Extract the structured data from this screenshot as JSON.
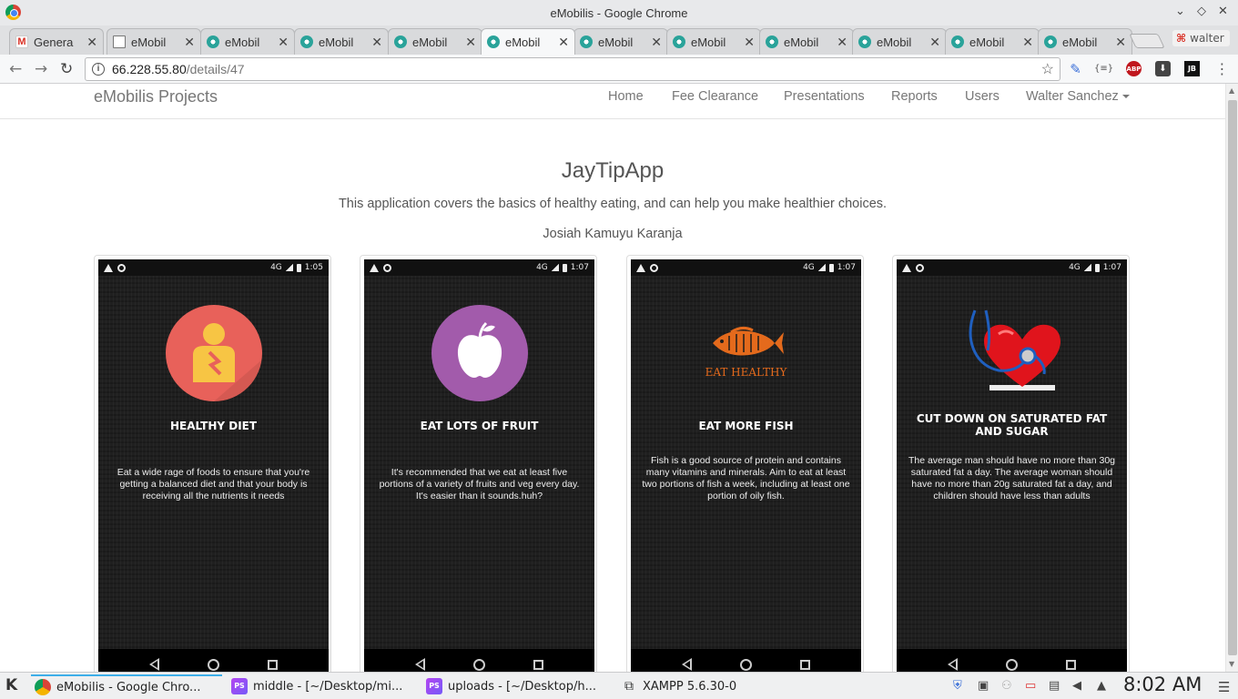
{
  "window": {
    "title": "eMobilis - Google Chrome"
  },
  "tabs": [
    {
      "label": "Genera",
      "icon": "gmail-icon",
      "active": false
    },
    {
      "label": "eMobil",
      "icon": "document-icon",
      "active": false
    },
    {
      "label": "eMobil",
      "icon": "emobilis-favicon",
      "active": false
    },
    {
      "label": "eMobil",
      "icon": "emobilis-favicon",
      "active": false
    },
    {
      "label": "eMobil",
      "icon": "emobilis-favicon",
      "active": false
    },
    {
      "label": "eMobil",
      "icon": "emobilis-favicon",
      "active": true
    },
    {
      "label": "eMobil",
      "icon": "emobilis-favicon",
      "active": false
    },
    {
      "label": "eMobil",
      "icon": "emobilis-favicon",
      "active": false
    },
    {
      "label": "eMobil",
      "icon": "emobilis-favicon",
      "active": false
    },
    {
      "label": "eMobil",
      "icon": "emobilis-favicon",
      "active": false
    },
    {
      "label": "eMobil",
      "icon": "emobilis-favicon",
      "active": false
    },
    {
      "label": "eMobil",
      "icon": "emobilis-favicon",
      "active": false
    }
  ],
  "profile": {
    "name": "walter"
  },
  "address": {
    "host": "66.228.55.80",
    "path": "/details/47"
  },
  "extensions": {
    "abp": "ABP",
    "jb": "JB",
    "bracket": "{≡}"
  },
  "site": {
    "brand": "eMobilis Projects",
    "nav": [
      "Home",
      "Fee Clearance",
      "Presentations",
      "Reports",
      "Users"
    ],
    "user_menu": "Walter Sanchez"
  },
  "project": {
    "title": "JayTipApp",
    "description": "This application covers the basics of healthy eating, and can help you make healthier choices.",
    "author": "Josiah Kamuyu Karanja"
  },
  "screens": [
    {
      "time": "1:05",
      "network": "4G",
      "heading": "HEALTHY DIET",
      "body": "Eat a wide rage of foods to ensure that you're getting a balanced diet and that your body is receiving all the nutrients it needs",
      "icon": "person-icon",
      "accent": "#e8615a"
    },
    {
      "time": "1:07",
      "network": "4G",
      "heading": "EAT LOTS OF FRUIT",
      "body": "It's recommended that we eat at least five portions of a variety of fruits and veg every day. It's easier than it sounds.huh?",
      "icon": "apple-icon",
      "accent": "#a25bab"
    },
    {
      "time": "1:07",
      "network": "4G",
      "heading": "EAT MORE FISH",
      "body": "Fish is a good source of protein and contains many vitamins and minerals. Aim to eat at least two portions of fish a week, including at least one portion of oily fish.",
      "icon": "fish-icon",
      "accent": "#e46a1c",
      "logo_text": "EAT HEALTHY"
    },
    {
      "time": "1:07",
      "network": "4G",
      "heading": "CUT DOWN ON SATURATED FAT AND SUGAR",
      "body": "The average man should have no more than 30g saturated fat a day. The average woman should have no more than 20g saturated fat a day, and children should have less than adults",
      "icon": "heart-stethoscope-icon",
      "accent": "#e0141c"
    }
  ],
  "taskbar": {
    "tasks": [
      "eMobilis - Google Chro...",
      "middle - [~/Desktop/mi...",
      "uploads - [~/Desktop/h...",
      "XAMPP 5.6.30-0"
    ],
    "clock": "8:02 AM"
  }
}
